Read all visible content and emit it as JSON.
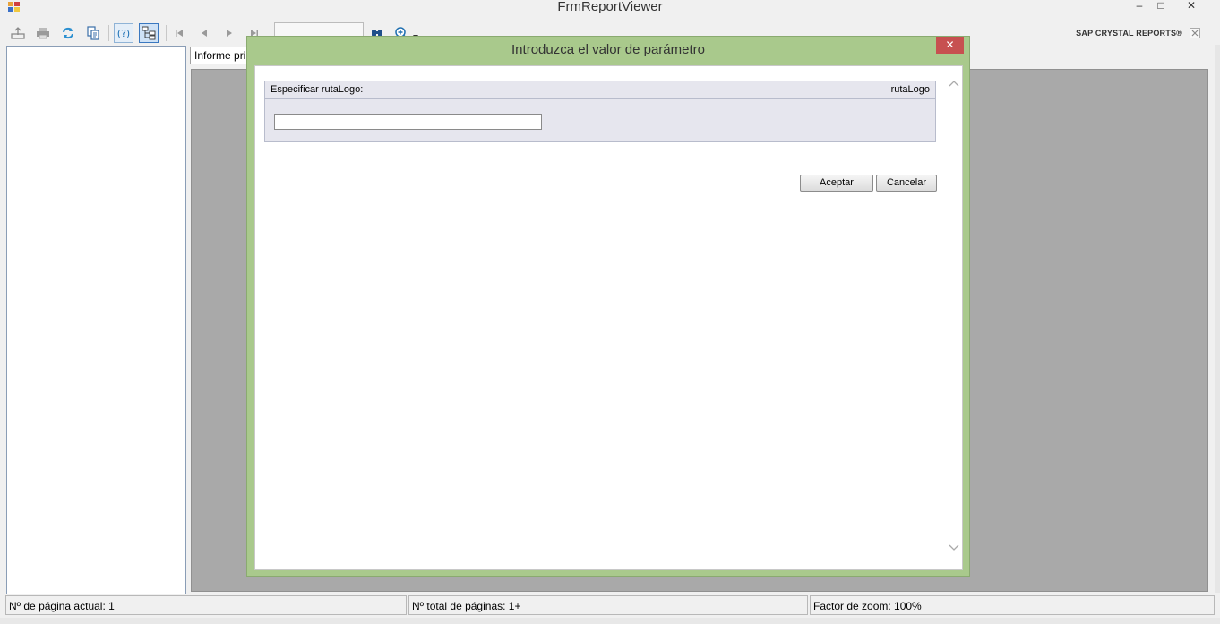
{
  "window": {
    "title": "FrmReportViewer",
    "minimize_glyph": "–",
    "maximize_glyph": "□",
    "close_glyph": "✕"
  },
  "toolbar": {
    "icons": [
      "export-icon",
      "print-icon",
      "refresh-icon",
      "copy-icon",
      "help-icon",
      "group-tree-icon",
      "first-page-icon",
      "previous-page-icon",
      "next-page-icon",
      "last-page-icon",
      "find-icon",
      "zoom-icon"
    ],
    "page_number_value": "",
    "brand": "SAP CRYSTAL REPORTS®"
  },
  "report": {
    "tab_label": "Informe principal"
  },
  "statusbar": {
    "current_page": "Nº de página actual: 1",
    "total_pages": "Nº total de páginas: 1+",
    "zoom": "Factor de zoom: 100%"
  },
  "dialog": {
    "title": "Introduzca el valor de parámetro",
    "close_glyph": "✕",
    "param_label": "Especificar rutaLogo:",
    "param_name": "rutaLogo",
    "param_value": "",
    "ok_label": "Aceptar",
    "cancel_label": "Cancelar"
  },
  "colors": {
    "dialog_frame": "#a9c98c",
    "dialog_close": "#c75050",
    "report_background": "#a9a9a9",
    "accent": "#1a6fb4"
  }
}
